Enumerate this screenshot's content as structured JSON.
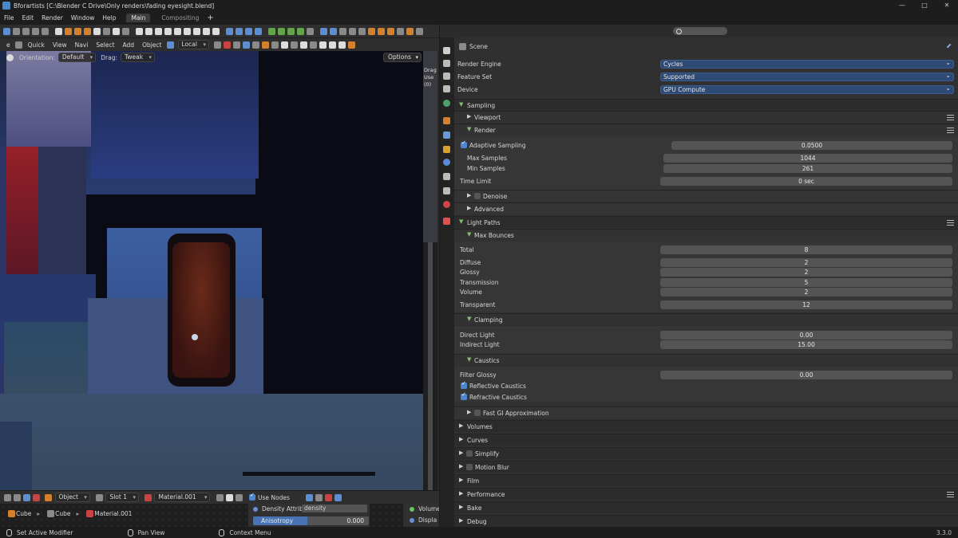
{
  "window": {
    "title": "Bforartists [C:\\Blender C Drive\\Only renders\\fading eyesight.blend]",
    "controls": [
      "—",
      "□",
      "✕"
    ]
  },
  "menubar": {
    "items": [
      "File",
      "Edit",
      "Render",
      "Window",
      "Help"
    ],
    "workspaces": [
      "Main",
      "Compositing"
    ],
    "add": "+"
  },
  "viewport_header": {
    "menus": [
      "e",
      "Quick",
      "View",
      "Navi",
      "Select",
      "Add",
      "Object"
    ],
    "pivot": "Local"
  },
  "viewport": {
    "orientation_label": "Orientation:",
    "orientation_value": "Default",
    "drag_label": "Drag:",
    "drag_value": "Tweak",
    "options": "Options",
    "side_text": [
      "Drag",
      "Use",
      "(0)"
    ]
  },
  "node_header": {
    "mode": "Object",
    "slot": "Slot 1",
    "material": "Material.001",
    "use_nodes": "Use Nodes"
  },
  "node_editor": {
    "breadcrumb": [
      "Cube",
      "Cube",
      "Material.001"
    ],
    "node_input_label": "Density Attrib...",
    "node_input_value": "density",
    "slider_label": "Anisotropy",
    "slider_value": "0.000",
    "slider_fill": 0.47,
    "output_labels": [
      "Volume",
      "Displa"
    ]
  },
  "properties": {
    "context": "Scene",
    "render_engine": {
      "label": "Render Engine",
      "value": "Cycles"
    },
    "feature_set": {
      "label": "Feature Set",
      "value": "Supported"
    },
    "device": {
      "label": "Device",
      "value": "GPU Compute"
    },
    "sampling": {
      "title": "Sampling",
      "viewport": "Viewport",
      "render": "Render",
      "adaptive_label": "Adaptive Sampling",
      "adaptive_value": "0.0500",
      "max_samples_label": "Max Samples",
      "max_samples": "1044",
      "min_samples_label": "Min Samples",
      "min_samples": "261",
      "time_limit_label": "Time Limit",
      "time_limit": "0 sec",
      "denoise": "Denoise",
      "advanced": "Advanced"
    },
    "light_paths": {
      "title": "Light Paths",
      "max_bounces": "Max Bounces",
      "total_label": "Total",
      "total": "8",
      "diffuse_label": "Diffuse",
      "diffuse": "2",
      "glossy_label": "Glossy",
      "glossy": "2",
      "transmission_label": "Transmission",
      "transmission": "5",
      "volume_label": "Volume",
      "volume": "2",
      "transparent_label": "Transparent",
      "transparent": "12",
      "clamping": "Clamping",
      "direct_light_label": "Direct Light",
      "direct_light": "0.00",
      "indirect_light_label": "Indirect Light",
      "indirect_light": "15.00",
      "caustics": "Caustics",
      "filter_glossy_label": "Filter Glossy",
      "filter_glossy": "0.00",
      "reflective_caustics": "Reflective Caustics",
      "refractive_caustics": "Refractive Caustics",
      "fast_gi": "Fast GI Approximation"
    },
    "panels": [
      "Volumes",
      "Curves",
      "Simplify",
      "Motion Blur",
      "Film",
      "Performance",
      "Bake",
      "Debug"
    ]
  },
  "statusbar": {
    "items": [
      "Set Active Modifier",
      "Pan View",
      "Context Menu"
    ],
    "version": "3.3.0"
  }
}
